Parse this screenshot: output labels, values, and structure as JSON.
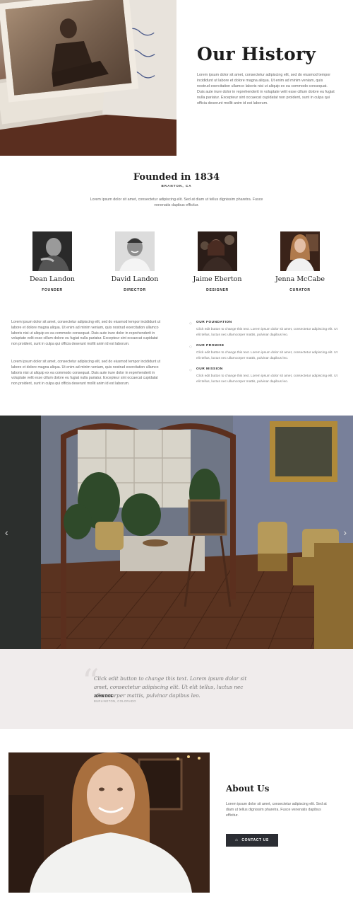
{
  "hero": {
    "title": "Our History",
    "text": "Lorem ipsum dolor sit amet, consectetur adipiscing elit, sed do eiusmod tempor incididunt ut labore et dolore magna aliqua. Ut enim ad minim veniam, quis nostrud exercitation ullamco laboris nisi ut aliquip ex ea commodo consequat. Duis aute irure dolor in reprehenderit in voluptate velit esse cillum dolore eu fugiat nulla pariatur. Excepteur sint occaecat cupidatat non proident, sunt in culpa qui officia deserunt mollit anim id est laborum."
  },
  "founded": {
    "title": "Founded in 1834",
    "location": "BRANTON, CA",
    "text": "Lorem ipsum dolor sit amet, consectetur adipiscing elit. Sed at diam ut tellus dignissim pharetra. Fusce venenatis dapibus efficitur."
  },
  "team": [
    {
      "name": "Dean Landon",
      "role": "FOUNDER"
    },
    {
      "name": "David Landon",
      "role": "DIRECTOR"
    },
    {
      "name": "Jaime Eberton",
      "role": "DESIGNER"
    },
    {
      "name": "Jenna McCabe",
      "role": "CURATOR"
    }
  ],
  "columns": {
    "left": [
      "Lorem ipsum dolor sit amet, consectetur adipiscing elit, sed do eiusmod tempor incididunt ut labore et dolore magna aliqua. Ut enim ad minim veniam, quis nostrud exercitation ullamco laboris nisi ut aliquip ex ea commodo consequat. Duis aute irure dolor in reprehenderit in voluptate velit esse cillum dolore eu fugiat nulla pariatur. Excepteur sint occaecat cupidatat non proident, sunt in culpa qui officia deserunt mollit anim id est laborum.",
      "Lorem ipsum dolor sit amet, consectetur adipiscing elit, sed do eiusmod tempor incididunt ut labore et dolore magna aliqua. Ut enim ad minim veniam, quis nostrud exercitation ullamco laboris nisi ut aliquip ex ea commodo consequat. Duis aute irure dolor in reprehenderit in voluptate velit esse cillum dolore eu fugiat nulla pariatur. Excepteur sint occaecat cupidatat non proident, sunt in culpa qui officia deserunt mollit anim id est laborum."
    ],
    "list": [
      {
        "title": "OUR FOUNDATION",
        "text": "Click edit button to change this text. Lorem ipsum dolor sit amet, consectetur adipiscing elit. Ut elit tellus, luctus nec ullamcorper mattis, pulvinar dapibus leo."
      },
      {
        "title": "OUR PROMISE",
        "text": "Click edit button to change this text. Lorem ipsum dolor sit amet, consectetur adipiscing elit. Ut elit tellus, luctus nec ullamcorper mattis, pulvinar dapibus leo."
      },
      {
        "title": "OUR MISSION",
        "text": "Click edit button to change this text. Lorem ipsum dolor sit amet, consectetur adipiscing elit. Ut elit tellus, luctus nec ullamcorper mattis, pulvinar dapibus leo."
      }
    ]
  },
  "slider": {
    "prev_icon": "‹",
    "next_icon": "›",
    "active_slide": 2,
    "slide_count": 4
  },
  "testimonial": {
    "quote_mark": "“",
    "text": "Click edit button to change this text. Lorem ipsum dolor sit amet, consectetur adipiscing elit. Ut elit tellus, luctus nec ullamcorper mattis, pulvinar dapibus leo.",
    "name": "JOHN DOE",
    "location": "BURLINGTON, COLORADO"
  },
  "about": {
    "title": "About Us",
    "text": "Lorem ipsum dolor sit amet, consectetur adipiscing elit. Sed at diam ut tellus dignissim pharetra. Fusce venenatis dapibus efficitur.",
    "button_label": "CONTACT US",
    "button_icon": "⌂"
  }
}
